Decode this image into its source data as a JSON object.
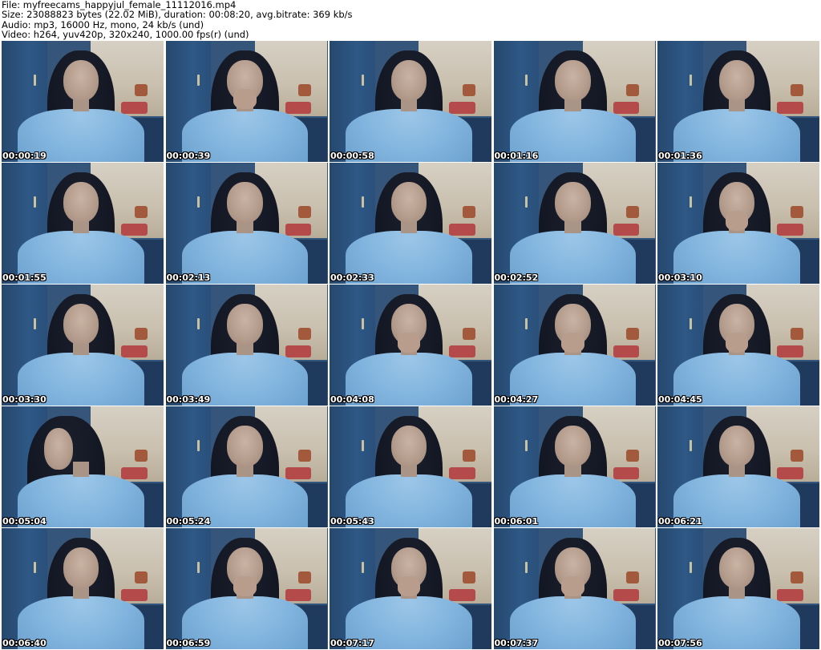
{
  "header": {
    "file": "File: myfreecams_happyjul_female_11112016.mp4",
    "size": "Size: 23088823 bytes (22.02 MiB), duration: 00:08:20, avg.bitrate: 369 kb/s",
    "audio": "Audio: mp3, 16000 Hz, mono, 24 kb/s (und)",
    "video": "Video: h264, yuv420p, 320x240, 1000.00 fps(r) (und)"
  },
  "thumbnails": [
    {
      "timestamp": "00:00:19",
      "pose": "neutral"
    },
    {
      "timestamp": "00:00:39",
      "pose": "hand"
    },
    {
      "timestamp": "00:00:58",
      "pose": "neutral"
    },
    {
      "timestamp": "00:01:16",
      "pose": "neutral"
    },
    {
      "timestamp": "00:01:36",
      "pose": "neutral"
    },
    {
      "timestamp": "00:01:55",
      "pose": "neutral"
    },
    {
      "timestamp": "00:02:13",
      "pose": "neutral"
    },
    {
      "timestamp": "00:02:33",
      "pose": "neutral"
    },
    {
      "timestamp": "00:02:52",
      "pose": "neutral"
    },
    {
      "timestamp": "00:03:10",
      "pose": "hand"
    },
    {
      "timestamp": "00:03:30",
      "pose": "neutral"
    },
    {
      "timestamp": "00:03:49",
      "pose": "neutral"
    },
    {
      "timestamp": "00:04:08",
      "pose": "hand"
    },
    {
      "timestamp": "00:04:27",
      "pose": "hand"
    },
    {
      "timestamp": "00:04:45",
      "pose": "hand"
    },
    {
      "timestamp": "00:05:04",
      "pose": "side"
    },
    {
      "timestamp": "00:05:24",
      "pose": "neutral"
    },
    {
      "timestamp": "00:05:43",
      "pose": "neutral"
    },
    {
      "timestamp": "00:06:01",
      "pose": "neutral"
    },
    {
      "timestamp": "00:06:21",
      "pose": "neutral"
    },
    {
      "timestamp": "00:06:40",
      "pose": "neutral"
    },
    {
      "timestamp": "00:06:59",
      "pose": "hand"
    },
    {
      "timestamp": "00:07:17",
      "pose": "hand"
    },
    {
      "timestamp": "00:07:37",
      "pose": "hand"
    },
    {
      "timestamp": "00:07:56",
      "pose": "neutral"
    }
  ]
}
